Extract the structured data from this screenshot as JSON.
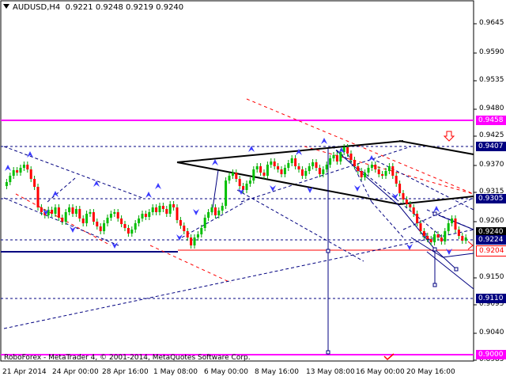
{
  "header": {
    "symbol": "AUDUSD,H4",
    "ohlc": "0.9221 0.9248 0.9219 0.9240"
  },
  "footer": {
    "copyright": "RoboForex - MetaTrader 4, © 2001-2014, MetaQuotes Software Corp."
  },
  "price_axis": {
    "ticks": [
      "0.9645",
      "0.9590",
      "0.9535",
      "0.9480",
      "0.9425",
      "0.9370",
      "0.9315",
      "0.9260",
      "0.9150",
      "0.9095",
      "0.9040",
      "0.8985"
    ],
    "tags": [
      {
        "label": "0.9458",
        "value": 0.9458,
        "bg": "#ff00ff",
        "fg": "#ffffff"
      },
      {
        "label": "0.9407",
        "value": 0.9407,
        "bg": "#000080",
        "fg": "#ffffff"
      },
      {
        "label": "0.9305",
        "value": 0.9305,
        "bg": "#000080",
        "fg": "#ffffff"
      },
      {
        "label": "0.9240",
        "value": 0.924,
        "bg": "#000000",
        "fg": "#ffffff"
      },
      {
        "label": "0.9224",
        "value": 0.9224,
        "bg": "#000080",
        "fg": "#ffffff"
      },
      {
        "label": "0.9204",
        "value": 0.9204,
        "bg": "#ffffff",
        "fg": "#ff0000"
      },
      {
        "label": "0.9110",
        "value": 0.911,
        "bg": "#000080",
        "fg": "#ffffff"
      },
      {
        "label": "0.9000",
        "value": 0.9,
        "bg": "#ff00ff",
        "fg": "#ffffff"
      }
    ]
  },
  "time_axis": {
    "ticks": [
      "21 Apr 2014",
      "24 Apr 00:00",
      "28 Apr 16:00",
      "1 May 08:00",
      "6 May 00:00",
      "8 May 16:00",
      "13 May 08:00",
      "16 May 00:00",
      "20 May 16:00"
    ]
  },
  "chart_data": {
    "type": "candlestick",
    "symbol": "AUDUSD",
    "timeframe": "H4",
    "last_bar_ohlc": {
      "open": 0.9221,
      "high": 0.9248,
      "low": 0.9219,
      "close": 0.924
    },
    "horizontal_levels": [
      {
        "value": 0.9458,
        "color": "#ff00ff",
        "style": "solid"
      },
      {
        "value": 0.9407,
        "color": "#000080",
        "style": "dashed"
      },
      {
        "value": 0.9305,
        "color": "#000080",
        "style": "dashed"
      },
      {
        "value": 0.9224,
        "color": "#000080",
        "style": "dashed"
      },
      {
        "value": 0.9204,
        "color": "#ff0000",
        "style": "solid"
      },
      {
        "value": 0.911,
        "color": "#000080",
        "style": "dashed"
      },
      {
        "value": 0.9,
        "color": "#ff00ff",
        "style": "solid"
      }
    ],
    "colors": {
      "bull": "#00c000",
      "bear": "#ff0000",
      "wick": "#00a000",
      "line": "#000080",
      "text": "#000000"
    }
  }
}
